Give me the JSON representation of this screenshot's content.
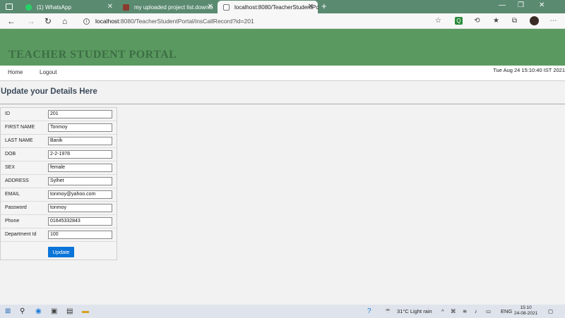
{
  "browser": {
    "tabs": [
      {
        "title": "(1) WhatsApp",
        "color": "#25D366"
      },
      {
        "title": "my uploaded project list.downlo",
        "color": "#8b3a2e"
      },
      {
        "title": "localhost:8080/TeacherStudentPc",
        "color": "#777777"
      }
    ],
    "address": {
      "host": "localhost",
      "rest": ":8080/TeacherStudentPortal/insCallRecord?id=201"
    }
  },
  "site": {
    "brand": "TEACHER STUDENT PORTAL",
    "menu": {
      "home": "Home",
      "logout": "Logout"
    },
    "datetime": "Tue Aug 24 15:10:40 IST 2021"
  },
  "page": {
    "title": "Update your Details Here",
    "fields": [
      {
        "label": "ID",
        "value": "201"
      },
      {
        "label": "FIRST NAME",
        "value": "Tonmoy"
      },
      {
        "label": "LAST NAME",
        "value": "Banik"
      },
      {
        "label": "DOB",
        "value": "2-2-1978"
      },
      {
        "label": "SEX",
        "value": "female"
      },
      {
        "label": "ADDRESS",
        "value": "Sylhet"
      },
      {
        "label": "EMAIL",
        "value": "tonmoy@yahoo.com"
      },
      {
        "label": "Password",
        "value": "tonmoy"
      },
      {
        "label": "Phone",
        "value": "01645332843"
      },
      {
        "label": "Department Id",
        "value": "100"
      }
    ],
    "submit_label": "Update"
  },
  "taskbar": {
    "weather": "31°C  Light rain",
    "lang": "ENG",
    "time": "15:10",
    "date": "24-08-2021"
  },
  "colors": {
    "header_green": "#5a9a60",
    "brand_text": "#3d6e45",
    "button_blue": "#0a74d8"
  }
}
